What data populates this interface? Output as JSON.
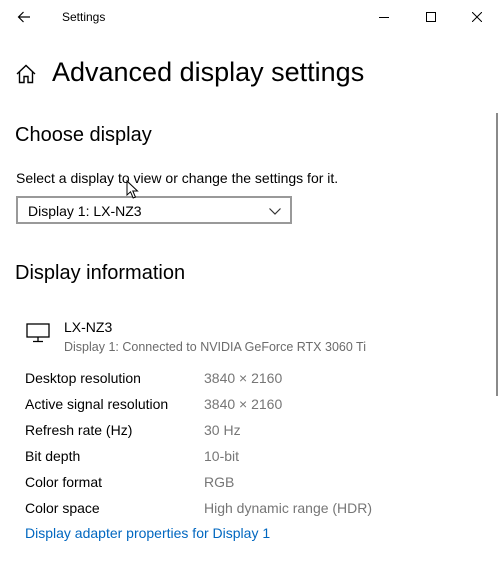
{
  "window": {
    "title": "Settings"
  },
  "header": {
    "page_title": "Advanced display settings"
  },
  "choose_display": {
    "heading": "Choose display",
    "select_label": "Select a display to view or change the settings for it.",
    "selected_display": "Display 1: LX-NZ3"
  },
  "display_information": {
    "heading": "Display information",
    "monitor_name": "LX-NZ3",
    "monitor_description": "Display 1: Connected to NVIDIA GeForce RTX 3060 Ti",
    "rows": [
      {
        "label": "Desktop resolution",
        "value": "3840 × 2160"
      },
      {
        "label": "Active signal resolution",
        "value": "3840 × 2160"
      },
      {
        "label": "Refresh rate (Hz)",
        "value": "30 Hz"
      },
      {
        "label": "Bit depth",
        "value": "10-bit"
      },
      {
        "label": "Color format",
        "value": "RGB"
      },
      {
        "label": "Color space",
        "value": "High dynamic range (HDR)"
      }
    ],
    "adapter_link": "Display adapter properties for Display 1"
  },
  "icons": {
    "back": "back-arrow-icon",
    "minimize": "minimize-icon",
    "maximize": "maximize-icon",
    "close": "close-icon",
    "home": "home-icon",
    "dropdown": "chevron-down-icon",
    "monitor": "monitor-icon",
    "cursor": "mouse-pointer-icon"
  },
  "colors": {
    "link": "#0067c0",
    "secondary_text": "#767676",
    "dropdown_border": "#999999"
  }
}
